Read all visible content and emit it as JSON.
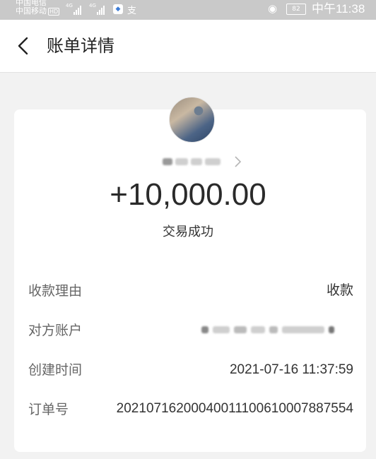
{
  "status_bar": {
    "carrier_1": "中国电信",
    "carrier_2": "中国移动",
    "hd_badge": "HD",
    "signal_1_label": "4G",
    "signal_2_label": "4G",
    "battery": "82",
    "time": "中午11:38"
  },
  "header": {
    "title": "账单详情",
    "back_icon": "chevron-left-icon"
  },
  "transaction": {
    "amount": "+10,000.00",
    "status": "交易成功"
  },
  "details": [
    {
      "label": "收款理由",
      "value": "收款"
    },
    {
      "label": "对方账户",
      "value": ""
    },
    {
      "label": "创建时间",
      "value": "2021-07-16 11:37:59"
    },
    {
      "label": "订单号",
      "value": "20210716200040011100610007887554"
    }
  ],
  "colors": {
    "background": "#f2f2f2",
    "card": "#ffffff",
    "status_bar": "#c9c9c9"
  }
}
